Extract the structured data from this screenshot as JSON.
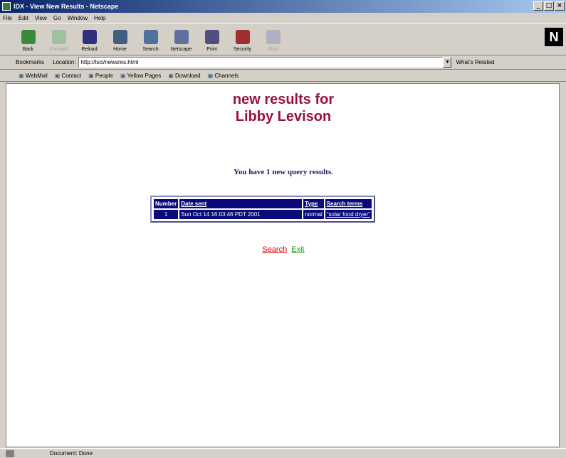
{
  "window": {
    "title": "IDX - View New Results - Netscape",
    "controls": [
      "_",
      "□",
      "×"
    ]
  },
  "menu": [
    "File",
    "Edit",
    "View",
    "Go",
    "Window",
    "Help"
  ],
  "toolbar": [
    {
      "label": "Back",
      "icon": "back-arrow-icon",
      "color": "#3a8a3a",
      "disabled": false
    },
    {
      "label": "Forward",
      "icon": "forward-arrow-icon",
      "color": "#a0c0a0",
      "disabled": true
    },
    {
      "label": "Reload",
      "icon": "reload-icon",
      "color": "#303080",
      "disabled": false
    },
    {
      "label": "Home",
      "icon": "home-icon",
      "color": "#406080",
      "disabled": false
    },
    {
      "label": "Search",
      "icon": "search-icon",
      "color": "#5070a0",
      "disabled": false
    },
    {
      "label": "Netscape",
      "icon": "netscape-icon",
      "color": "#6070a0",
      "disabled": false
    },
    {
      "label": "Print",
      "icon": "print-icon",
      "color": "#505080",
      "disabled": false
    },
    {
      "label": "Security",
      "icon": "security-icon",
      "color": "#a03030",
      "disabled": false
    },
    {
      "label": "Stop",
      "icon": "stop-icon",
      "color": "#b0b0c0",
      "disabled": true
    }
  ],
  "logo": "N",
  "location": {
    "bookmarks_label": "Bookmarks",
    "location_label": "Location:",
    "url": "http://lsci/newsres.html",
    "related_label": "What's Related"
  },
  "personal_toolbar": [
    "WebMail",
    "Contact",
    "People",
    "Yellow Pages",
    "Download",
    "Channels"
  ],
  "page": {
    "headline_line1": "new results for",
    "headline_line2": "Libby Levison",
    "notice": "You have 1 new query results.",
    "table": {
      "headers": [
        "Number",
        "Date sent",
        "Type",
        "Search terms"
      ],
      "rows": [
        {
          "number": "1",
          "date": "Sun Oct 14 16:03:46 PDT 2001",
          "type": "normal",
          "terms": "\"solar food dryer\""
        }
      ]
    },
    "links": {
      "search": "Search",
      "exit": "Exit"
    }
  },
  "status": {
    "text": "Document: Done"
  },
  "colors": {
    "headline": "#99113a",
    "table_bg": "#0a0a7a",
    "search_link": "#d00000",
    "exit_link": "#10a010"
  }
}
